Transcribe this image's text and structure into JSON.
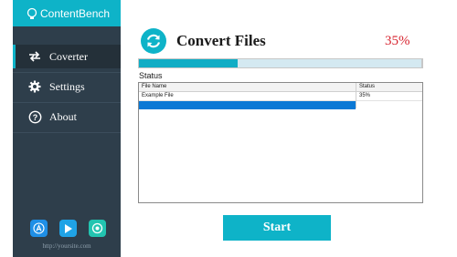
{
  "app": {
    "brand": "ContentBench"
  },
  "sidebar": {
    "items": [
      {
        "label": "Coverter",
        "icon": "swap-arrows-icon",
        "active": true
      },
      {
        "label": "Settings",
        "icon": "gear-icon",
        "active": false
      },
      {
        "label": "About",
        "icon": "question-circle-icon",
        "active": false
      }
    ],
    "social_icons": [
      "app-store-icon",
      "play-store-icon",
      "chat-icon"
    ],
    "site_url": "http://yoursite.com"
  },
  "main": {
    "title": "Convert Files",
    "progress_text": "35%",
    "progress_value": 0.35,
    "status_label": "Status",
    "table": {
      "columns": [
        "File Name",
        "Status"
      ],
      "rows": [
        {
          "file_name": "Example File",
          "status": "35%"
        }
      ]
    },
    "start_label": "Start"
  },
  "colors": {
    "accent": "#0eb3c8",
    "sidebar_bg": "#2e3e4b",
    "percent_text": "#d7242f",
    "selection": "#0a78d5"
  }
}
